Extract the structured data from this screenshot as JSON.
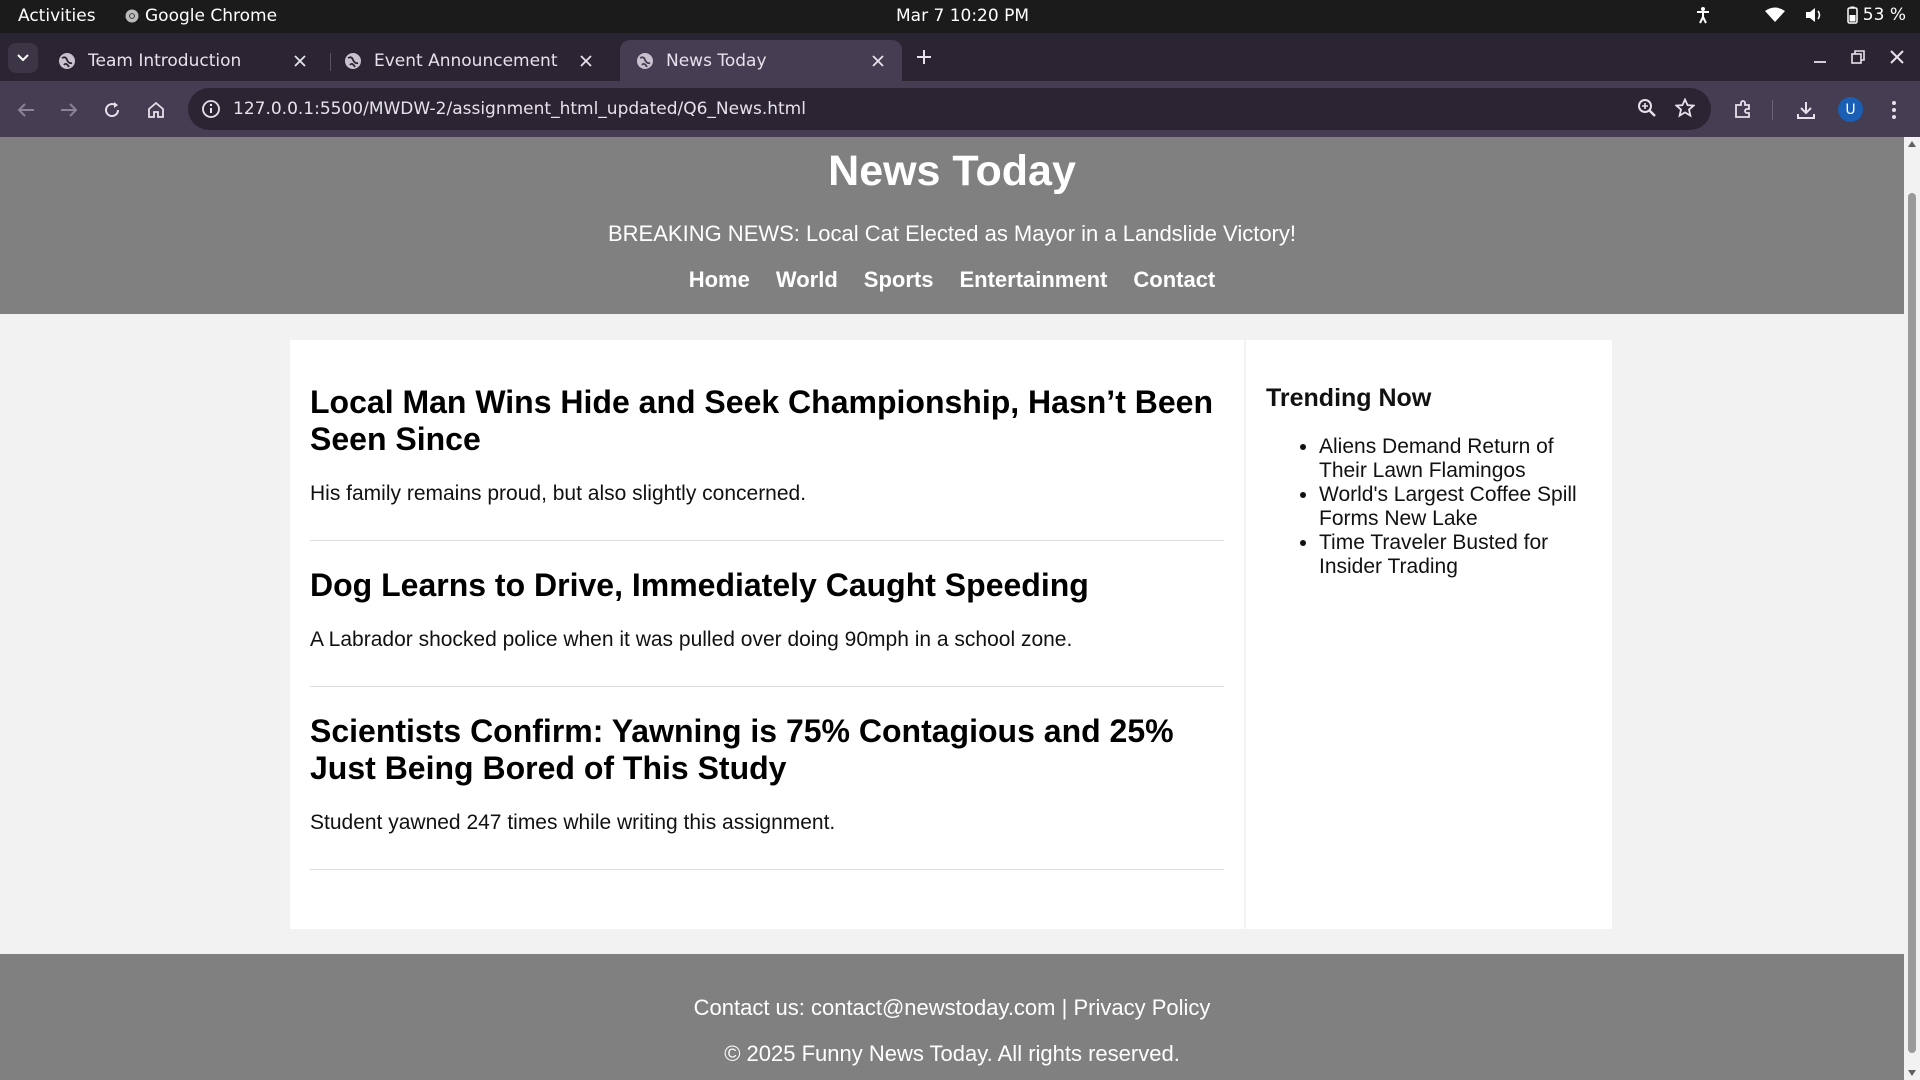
{
  "os_bar": {
    "activities": "Activities",
    "app_name": "Google Chrome",
    "clock": "Mar 7  10:20 PM",
    "battery": "53 %"
  },
  "tabs": [
    {
      "title": "Team Introduction",
      "active": false
    },
    {
      "title": "Event Announcement",
      "active": false
    },
    {
      "title": "News Today",
      "active": true
    }
  ],
  "toolbar": {
    "url": "127.0.0.1:5500/MWDW-2/assignment_html_updated/Q6_News.html",
    "avatar_letter": "U"
  },
  "page": {
    "site_title": "News Today",
    "breaking": "BREAKING NEWS: Local Cat Elected as Mayor in a Landslide Victory!",
    "nav": [
      "Home",
      "World",
      "Sports",
      "Entertainment",
      "Contact"
    ],
    "articles": [
      {
        "headline": "Local Man Wins Hide and Seek Championship, Hasn’t Been Seen Since",
        "summary": "His family remains proud, but also slightly concerned."
      },
      {
        "headline": "Dog Learns to Drive, Immediately Caught Speeding",
        "summary": "A Labrador shocked police when it was pulled over doing 90mph in a school zone."
      },
      {
        "headline": "Scientists Confirm: Yawning is 75% Contagious and 25% Just Being Bored of This Study",
        "summary": "Student yawned 247 times while writing this assignment."
      }
    ],
    "trending": {
      "title": "Trending Now",
      "items": [
        "Aliens Demand Return of Their Lawn Flamingos",
        "World's Largest Coffee Spill Forms New Lake",
        "Time Traveler Busted for Insider Trading"
      ]
    },
    "footer": {
      "contact_prefix": "Contact us: ",
      "email": "contact@newstoday.com",
      "separator": " | ",
      "privacy": "Privacy Policy",
      "copyright": "© 2025 Funny News Today. All rights reserved."
    }
  },
  "colors": {
    "header_bg": "#808080",
    "page_bg": "#f2f2f2",
    "tab_strip": "#2b2533",
    "toolbar": "#453d52"
  }
}
